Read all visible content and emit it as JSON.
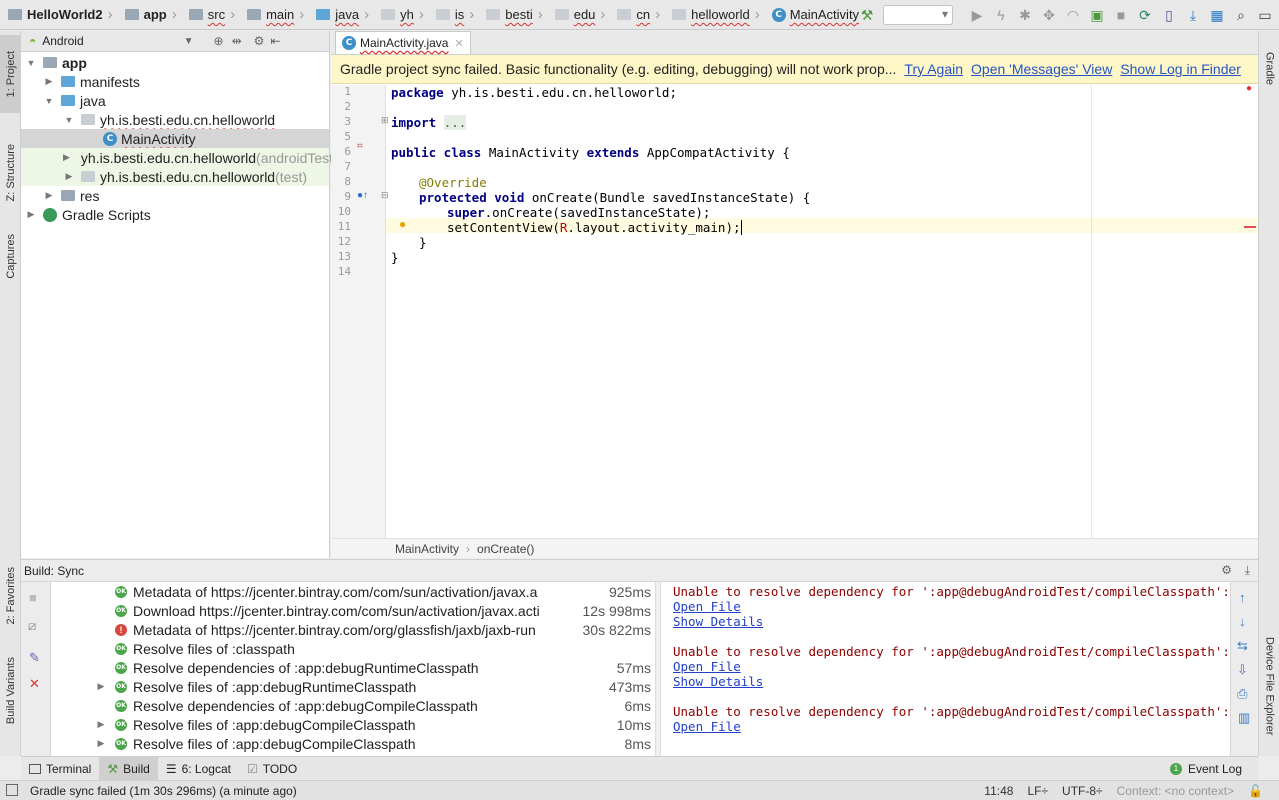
{
  "navbar": {
    "breadcrumbs": [
      {
        "label": "HelloWorld2",
        "icon": "folder-icon"
      },
      {
        "label": "app",
        "icon": "folder-icon"
      },
      {
        "label": "src",
        "icon": "folder-icon"
      },
      {
        "label": "main",
        "icon": "folder-icon"
      },
      {
        "label": "java",
        "icon": "folder-icon"
      },
      {
        "label": "yh",
        "icon": "package-icon"
      },
      {
        "label": "is",
        "icon": "package-icon"
      },
      {
        "label": "besti",
        "icon": "package-icon"
      },
      {
        "label": "edu",
        "icon": "package-icon"
      },
      {
        "label": "cn",
        "icon": "package-icon"
      },
      {
        "label": "helloworld",
        "icon": "package-icon"
      },
      {
        "label": "MainActivity",
        "icon": "class-icon"
      }
    ],
    "class_icon_letter": "C"
  },
  "left_strip": {
    "project_tab": "1: Project",
    "structure_tab": "Z: Structure",
    "captures_tab": "Captures",
    "favorites_tab": "2: Favorites",
    "build_variants_tab": "Build Variants"
  },
  "right_strip": {
    "gradle_tab": "Gradle",
    "device_tab": "Device File Explorer"
  },
  "project": {
    "view_mode": "Android",
    "tree": [
      {
        "label": "app",
        "suffix": ""
      },
      {
        "label": "manifests",
        "suffix": ""
      },
      {
        "label": "java",
        "suffix": ""
      },
      {
        "label": "yh.is.besti.edu.cn.helloworld",
        "suffix": ""
      },
      {
        "label": "MainActivity",
        "suffix": ""
      },
      {
        "label": "yh.is.besti.edu.cn.helloworld",
        "suffix": " (androidTest)"
      },
      {
        "label": "yh.is.besti.edu.cn.helloworld",
        "suffix": " (test)"
      },
      {
        "label": "res",
        "suffix": ""
      },
      {
        "label": "Gradle Scripts",
        "suffix": ""
      }
    ]
  },
  "editor": {
    "tab_label": "MainActivity.java",
    "banner_text": "Gradle project sync failed. Basic functionality (e.g. editing, debugging) will not work prop...",
    "banner_links": [
      "Try Again",
      "Open 'Messages' View",
      "Show Log in Finder"
    ],
    "line_numbers": [
      "1",
      "2",
      "3",
      "5",
      "6",
      "7",
      "8",
      "9",
      "10",
      "11",
      "12",
      "13",
      "14"
    ],
    "code": {
      "l1_kw": "package",
      "l1_rest": " yh.is.besti.edu.cn.helloworld;",
      "l3_kw": "import",
      "l3_fold": "...",
      "l6_kw1": "public class",
      "l6_mid": " MainActivity ",
      "l6_kw2": "extends",
      "l6_rest": " AppCompatActivity {",
      "l8_ann": "@Override",
      "l9_kw": "protected void",
      "l9_rest": " onCreate(Bundle savedInstanceState) {",
      "l10_kw": "super",
      "l10_rest": ".onCreate(savedInstanceState);",
      "l11_pre": "setContentView(",
      "l11_r": "R",
      "l11_rest": ".layout.activity_main);",
      "l12": "}",
      "l13": "}"
    },
    "crumb_class": "MainActivity",
    "crumb_method": "onCreate()"
  },
  "build": {
    "title": "Build: Sync",
    "rows": [
      {
        "label": "Metadata of https://jcenter.bintray.com/com/sun/activation/javax.a",
        "time": "925ms",
        "status": "ok",
        "expandable": false
      },
      {
        "label": "Download https://jcenter.bintray.com/com/sun/activation/javax.acti",
        "time": "12s 998ms",
        "status": "ok",
        "expandable": false
      },
      {
        "label": "Metadata of https://jcenter.bintray.com/org/glassfish/jaxb/jaxb-run",
        "time": "30s 822ms",
        "status": "error",
        "expandable": false
      },
      {
        "label": "Resolve files of :classpath",
        "time": "",
        "status": "ok",
        "expandable": false
      },
      {
        "label": "Resolve dependencies of :app:debugRuntimeClasspath",
        "time": "57ms",
        "status": "ok",
        "expandable": false
      },
      {
        "label": "Resolve files of :app:debugRuntimeClasspath",
        "time": "473ms",
        "status": "ok",
        "expandable": true
      },
      {
        "label": "Resolve dependencies of :app:debugCompileClasspath",
        "time": "6ms",
        "status": "ok",
        "expandable": false
      },
      {
        "label": "Resolve files of :app:debugCompileClasspath",
        "time": "10ms",
        "status": "ok",
        "expandable": true
      },
      {
        "label": "Resolve files of :app:debugCompileClasspath",
        "time": "8ms",
        "status": "ok",
        "expandable": true
      }
    ],
    "ok_badge": "OK",
    "error_badge": "!",
    "output": [
      {
        "text": "Unable to resolve dependency for ':app@debugAndroidTest/compileClasspath': Could",
        "kind": "error"
      },
      {
        "text": "Open File",
        "kind": "link"
      },
      {
        "text": "Show Details",
        "kind": "link"
      },
      {
        "text": "",
        "kind": "blank"
      },
      {
        "text": "Unable to resolve dependency for ':app@debugAndroidTest/compileClasspath': Could",
        "kind": "error"
      },
      {
        "text": "Open File",
        "kind": "link"
      },
      {
        "text": "Show Details",
        "kind": "link"
      },
      {
        "text": "",
        "kind": "blank"
      },
      {
        "text": "Unable to resolve dependency for ':app@debugAndroidTest/compileClasspath': Could",
        "kind": "error"
      },
      {
        "text": "Open File",
        "kind": "link"
      }
    ]
  },
  "bottom_tabs": {
    "terminal": "Terminal",
    "build": "Build",
    "logcat": "6: Logcat",
    "todo": "TODO",
    "event_log": "Event Log",
    "event_count": "1"
  },
  "status": {
    "message": "Gradle sync failed (1m 30s 296ms) (a minute ago)",
    "position": "11:48",
    "line_sep": "LF÷",
    "encoding": "UTF-8÷",
    "context": "Context: <no context>"
  }
}
